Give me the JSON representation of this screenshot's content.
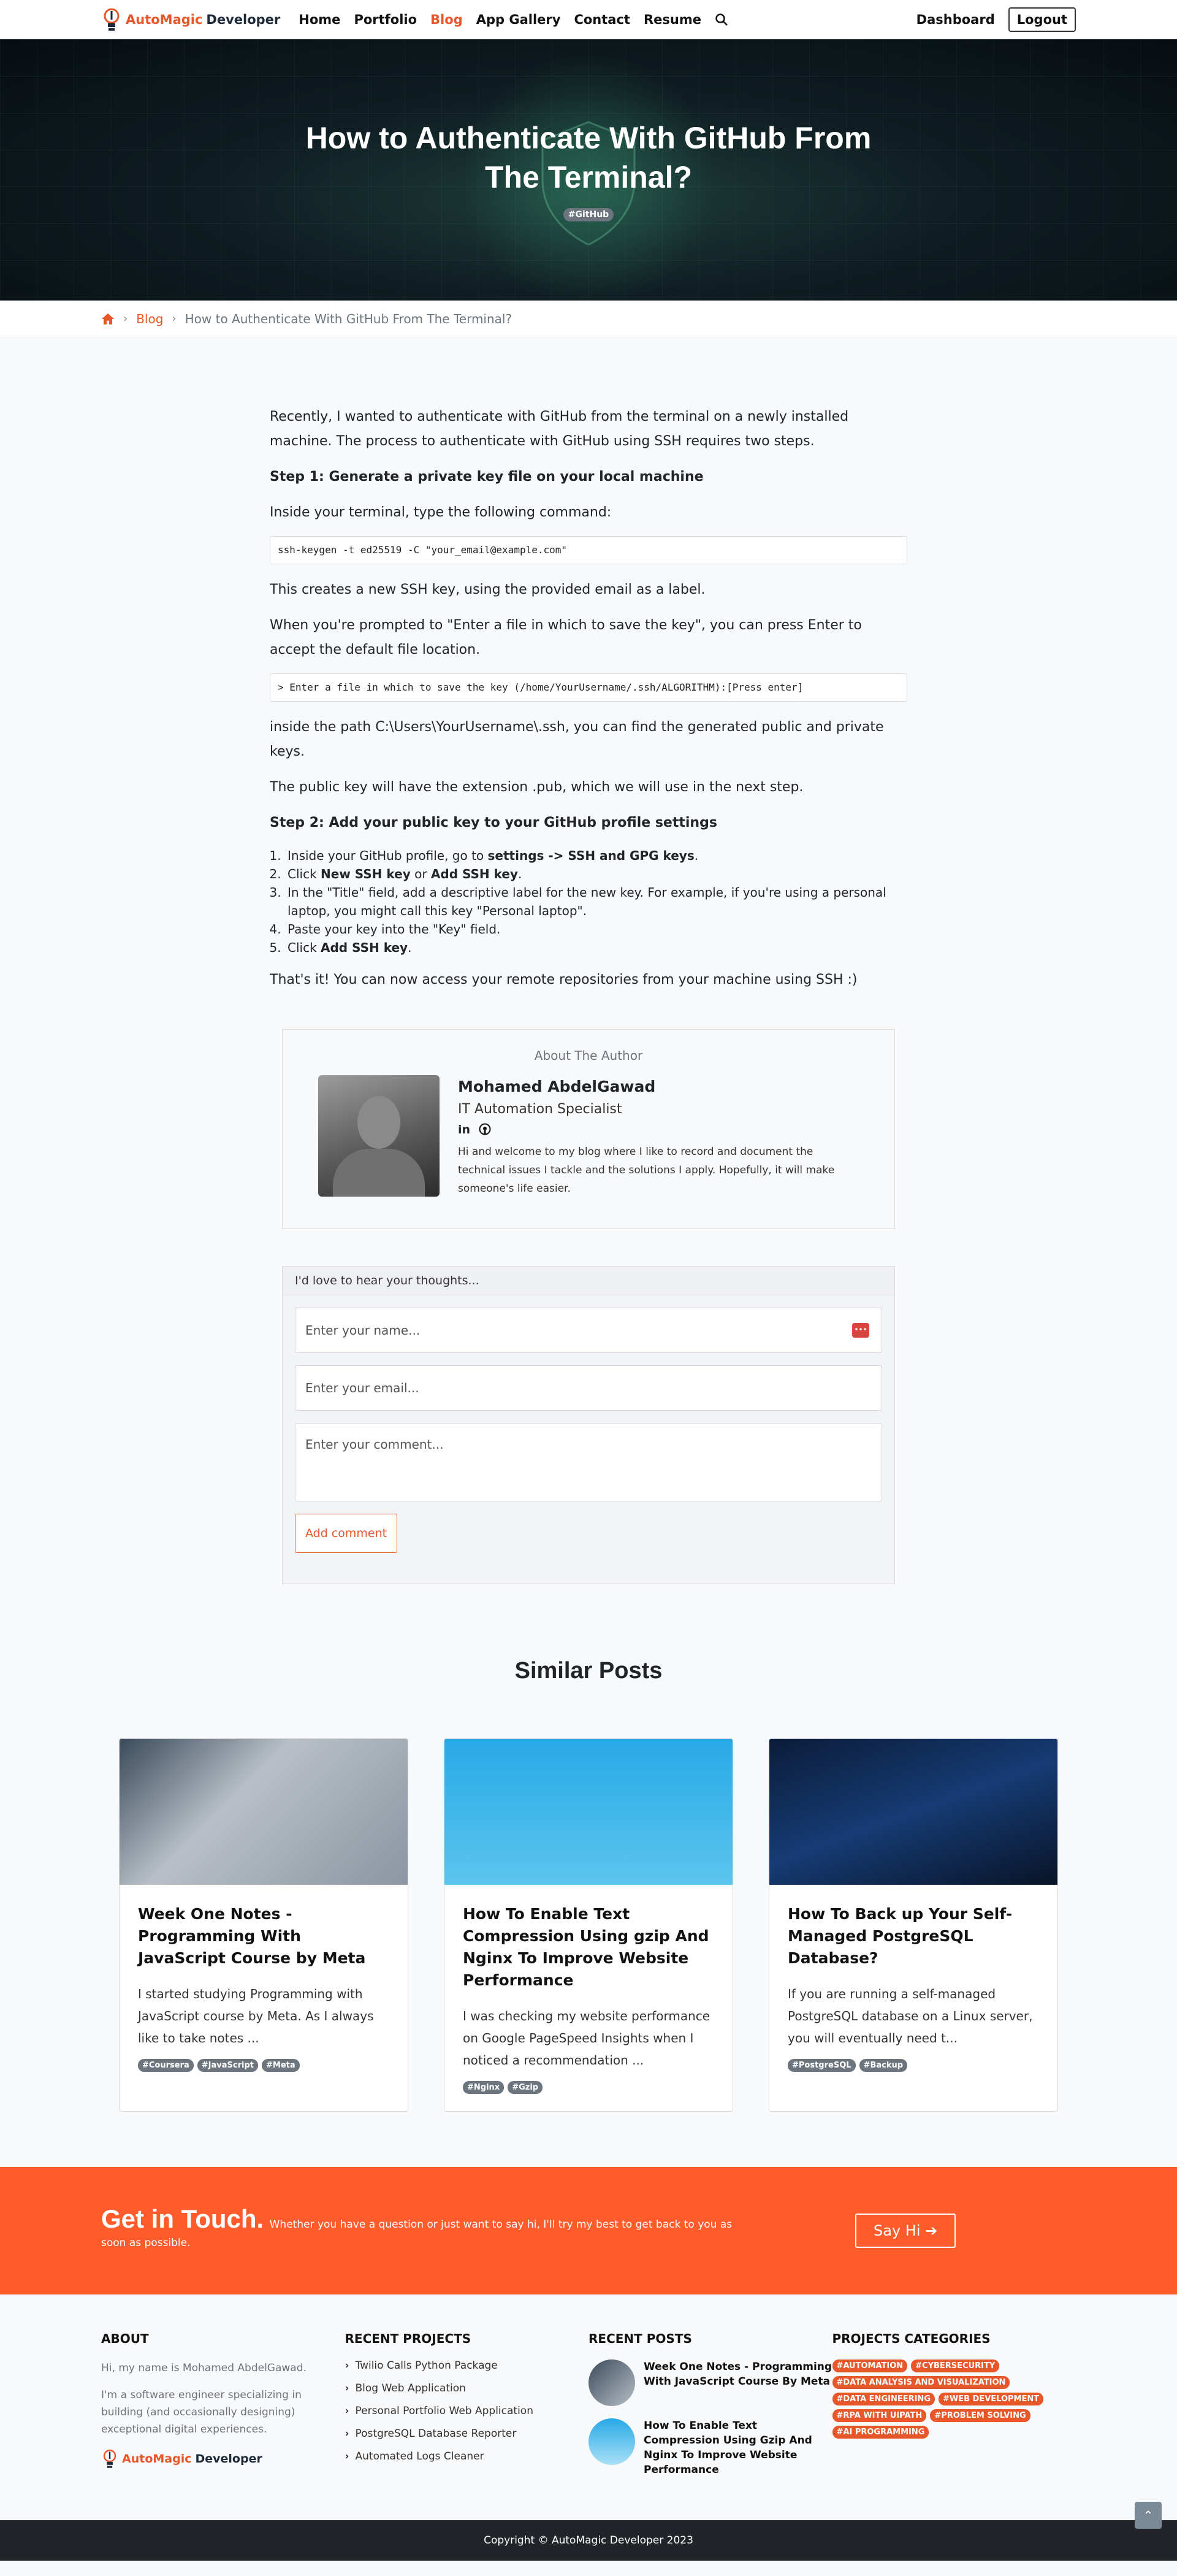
{
  "nav": {
    "brand_a": "AutoMagic",
    "brand_b": "Developer",
    "links": [
      "Home",
      "Portfolio",
      "Blog",
      "App Gallery",
      "Contact",
      "Resume"
    ],
    "active": "Blog",
    "dashboard": "Dashboard",
    "logout": "Logout"
  },
  "hero": {
    "title": "How to Authenticate With GitHub From The Terminal?",
    "tag": "#GitHub"
  },
  "breadcrumb": {
    "blog": "Blog",
    "current": "How to Authenticate With GitHub From The Terminal?"
  },
  "article": {
    "intro": "Recently, I wanted to authenticate with GitHub from the terminal on a newly installed machine. The process to authenticate with GitHub using SSH requires two steps.",
    "step1_heading": "Step 1: Generate a private key file on your local machine",
    "step1_p1": "Inside your terminal, type the following command:",
    "code1": "ssh-keygen -t ed25519 -C \"your_email@example.com\"",
    "step1_p2": "This creates a new SSH key, using the provided email as a label.",
    "step1_p3": "When you're prompted to \"Enter a file in which to save the key\", you can press Enter to accept the default file location.",
    "code2": "> Enter a file in which to save the key (/home/YourUsername/.ssh/ALGORITHM):[Press enter]",
    "step1_p4": "inside the path C:\\Users\\YourUsername\\.ssh, you can find the generated public and private keys.",
    "step1_p5": "The public key will have the extension .pub, which we will use in the next step.",
    "step2_heading": "Step 2: Add your public key to your GitHub profile settings",
    "list": [
      {
        "pre": "Inside your GitHub profile, go to ",
        "bold": "settings -> SSH and GPG keys",
        "post": "."
      },
      {
        "pre": "Click ",
        "bold": "New SSH key",
        "mid": " or ",
        "bold2": "Add SSH key",
        "post": "."
      },
      {
        "pre": "In the \"Title\" field, add a descriptive label for the new key. For example, if you're using a personal laptop, you might call this key \"Personal laptop\".",
        "bold": "",
        "post": ""
      },
      {
        "pre": "Paste your key into the \"Key\" field.",
        "bold": "",
        "post": ""
      },
      {
        "pre": "Click ",
        "bold": "Add SSH key",
        "post": "."
      }
    ],
    "outro": "That's it! You can now access your remote repositories from your machine using SSH :)"
  },
  "author": {
    "heading": "About The Author",
    "name": "Mohamed AbdelGawad",
    "role": "IT Automation Specialist",
    "linkedin": "in",
    "bio": "Hi and welcome to my blog where I like to record and document the technical issues I tackle and the solutions I apply. Hopefully, it will make someone's life easier."
  },
  "comment": {
    "heading": "I'd love to hear your thoughts...",
    "name_placeholder": "Enter your name...",
    "email_placeholder": "Enter your email...",
    "comment_placeholder": "Enter your comment...",
    "submit": "Add comment"
  },
  "similar": {
    "heading": "Similar Posts",
    "posts": [
      {
        "title": "Week One Notes - Programming With JavaScript Course by Meta",
        "excerpt": "I started studying Programming with JavaScript course by Meta. As I always like to take notes ...",
        "tags": [
          "#Coursera",
          "#JavaScript",
          "#Meta"
        ]
      },
      {
        "title": "How To Enable Text Compression Using gzip And Nginx To Improve Website Performance",
        "excerpt": "I was checking my website performance on Google PageSpeed Insights when I noticed a recommendation ...",
        "tags": [
          "#Nginx",
          "#Gzip"
        ]
      },
      {
        "title": "How To Back up Your Self-Managed PostgreSQL Database?",
        "excerpt": "If you are running a self-managed PostgreSQL database on a Linux server, you will eventually need t...",
        "tags": [
          "#PostgreSQL",
          "#Backup"
        ]
      }
    ]
  },
  "cta": {
    "title": "Get in Touch.",
    "text": "Whether you have a question or just want to say hi, I'll try my best to get back to you as soon as possible.",
    "button": "Say Hi"
  },
  "footer": {
    "about_heading": "ABOUT",
    "about_p1": "Hi, my name is Mohamed AbdelGawad.",
    "about_p2": "I'm a software engineer specializing in building (and occasionally designing) exceptional digital experiences.",
    "projects_heading": "RECENT PROJECTS",
    "projects": [
      "Twilio Calls Python Package",
      "Blog Web Application",
      "Personal Portfolio Web Application",
      "PostgreSQL Database Reporter",
      "Automated Logs Cleaner"
    ],
    "posts_heading": "RECENT POSTS",
    "recent_posts": [
      "Week One Notes - Programming With JavaScript Course By Meta",
      "How To Enable Text Compression Using Gzip And Nginx To Improve Website Performance"
    ],
    "cats_heading": "PROJECTS CATEGORIES",
    "categories": [
      "#AUTOMATION",
      "#CYBERSECURITY",
      "#DATA ANALYSIS AND VISUALIZATION",
      "#DATA ENGINEERING",
      "#WEB DEVELOPMENT",
      "#RPA WITH UIPATH",
      "#PROBLEM SOLVING",
      "#AI PROGRAMMING"
    ],
    "copyright": "Copyright © AutoMagic Developer 2023"
  },
  "colors": {
    "accent": "#e8572a",
    "cta": "#ff5b2b",
    "dark": "#212529"
  }
}
